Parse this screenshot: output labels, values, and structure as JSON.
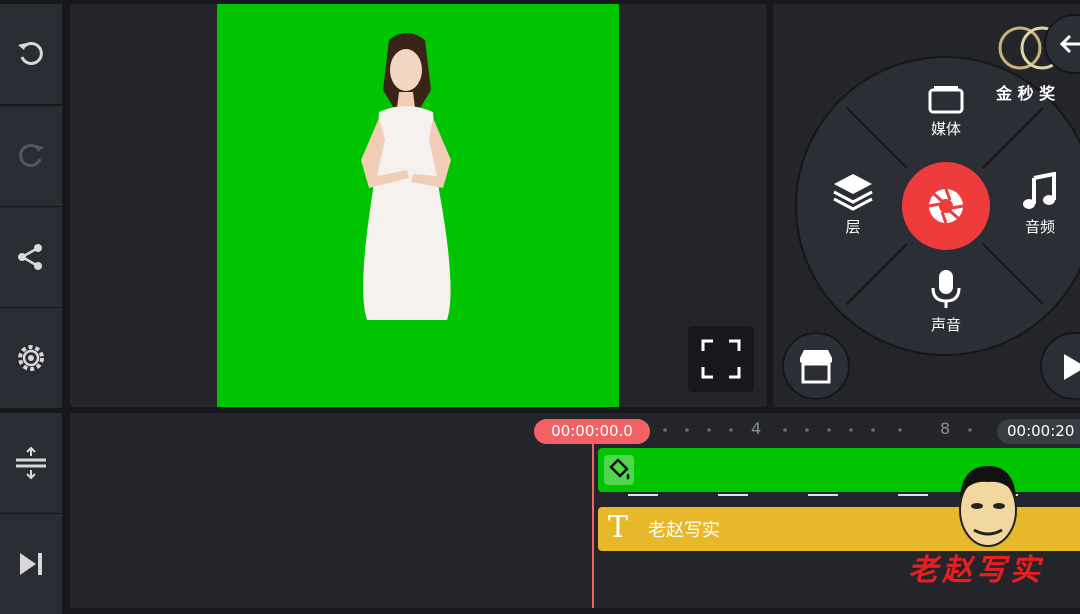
{
  "toolbar": {
    "undo_icon": "undo-icon",
    "redo_icon": "redo-icon",
    "share_icon": "share-icon",
    "settings_icon": "gear-icon",
    "split_icon": "split-track-icon",
    "skip_end_icon": "skip-to-end-icon"
  },
  "radial_menu": {
    "media_label": "媒体",
    "layer_label": "层",
    "audio_label": "音频",
    "voice_label": "声音"
  },
  "logo": {
    "text": "金 秒 奖"
  },
  "timeline": {
    "current_time": "00:00:00.0",
    "total_time": "00:00:20",
    "tick_4": "4",
    "tick_8": "8"
  },
  "text_track": {
    "label": "老赵写实"
  },
  "watermark": {
    "text": "老赵写实"
  },
  "colors": {
    "green_screen": "#00c400",
    "record_red": "#ee3c3c",
    "text_track_yellow": "#e7b92a",
    "playhead_red": "#f06263"
  }
}
